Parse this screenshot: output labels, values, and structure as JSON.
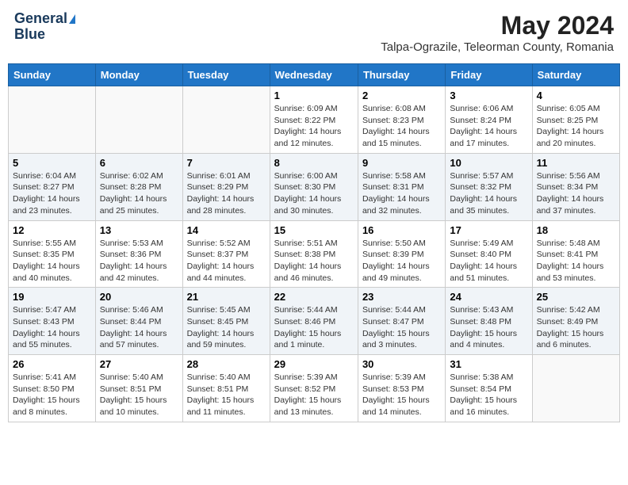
{
  "header": {
    "logo_line1": "General",
    "logo_line2": "Blue",
    "month_year": "May 2024",
    "location": "Talpa-Ograzile, Teleorman County, Romania"
  },
  "weekdays": [
    "Sunday",
    "Monday",
    "Tuesday",
    "Wednesday",
    "Thursday",
    "Friday",
    "Saturday"
  ],
  "weeks": [
    [
      {
        "day": "",
        "info": ""
      },
      {
        "day": "",
        "info": ""
      },
      {
        "day": "",
        "info": ""
      },
      {
        "day": "1",
        "info": "Sunrise: 6:09 AM\nSunset: 8:22 PM\nDaylight: 14 hours and 12 minutes."
      },
      {
        "day": "2",
        "info": "Sunrise: 6:08 AM\nSunset: 8:23 PM\nDaylight: 14 hours and 15 minutes."
      },
      {
        "day": "3",
        "info": "Sunrise: 6:06 AM\nSunset: 8:24 PM\nDaylight: 14 hours and 17 minutes."
      },
      {
        "day": "4",
        "info": "Sunrise: 6:05 AM\nSunset: 8:25 PM\nDaylight: 14 hours and 20 minutes."
      }
    ],
    [
      {
        "day": "5",
        "info": "Sunrise: 6:04 AM\nSunset: 8:27 PM\nDaylight: 14 hours and 23 minutes."
      },
      {
        "day": "6",
        "info": "Sunrise: 6:02 AM\nSunset: 8:28 PM\nDaylight: 14 hours and 25 minutes."
      },
      {
        "day": "7",
        "info": "Sunrise: 6:01 AM\nSunset: 8:29 PM\nDaylight: 14 hours and 28 minutes."
      },
      {
        "day": "8",
        "info": "Sunrise: 6:00 AM\nSunset: 8:30 PM\nDaylight: 14 hours and 30 minutes."
      },
      {
        "day": "9",
        "info": "Sunrise: 5:58 AM\nSunset: 8:31 PM\nDaylight: 14 hours and 32 minutes."
      },
      {
        "day": "10",
        "info": "Sunrise: 5:57 AM\nSunset: 8:32 PM\nDaylight: 14 hours and 35 minutes."
      },
      {
        "day": "11",
        "info": "Sunrise: 5:56 AM\nSunset: 8:34 PM\nDaylight: 14 hours and 37 minutes."
      }
    ],
    [
      {
        "day": "12",
        "info": "Sunrise: 5:55 AM\nSunset: 8:35 PM\nDaylight: 14 hours and 40 minutes."
      },
      {
        "day": "13",
        "info": "Sunrise: 5:53 AM\nSunset: 8:36 PM\nDaylight: 14 hours and 42 minutes."
      },
      {
        "day": "14",
        "info": "Sunrise: 5:52 AM\nSunset: 8:37 PM\nDaylight: 14 hours and 44 minutes."
      },
      {
        "day": "15",
        "info": "Sunrise: 5:51 AM\nSunset: 8:38 PM\nDaylight: 14 hours and 46 minutes."
      },
      {
        "day": "16",
        "info": "Sunrise: 5:50 AM\nSunset: 8:39 PM\nDaylight: 14 hours and 49 minutes."
      },
      {
        "day": "17",
        "info": "Sunrise: 5:49 AM\nSunset: 8:40 PM\nDaylight: 14 hours and 51 minutes."
      },
      {
        "day": "18",
        "info": "Sunrise: 5:48 AM\nSunset: 8:41 PM\nDaylight: 14 hours and 53 minutes."
      }
    ],
    [
      {
        "day": "19",
        "info": "Sunrise: 5:47 AM\nSunset: 8:43 PM\nDaylight: 14 hours and 55 minutes."
      },
      {
        "day": "20",
        "info": "Sunrise: 5:46 AM\nSunset: 8:44 PM\nDaylight: 14 hours and 57 minutes."
      },
      {
        "day": "21",
        "info": "Sunrise: 5:45 AM\nSunset: 8:45 PM\nDaylight: 14 hours and 59 minutes."
      },
      {
        "day": "22",
        "info": "Sunrise: 5:44 AM\nSunset: 8:46 PM\nDaylight: 15 hours and 1 minute."
      },
      {
        "day": "23",
        "info": "Sunrise: 5:44 AM\nSunset: 8:47 PM\nDaylight: 15 hours and 3 minutes."
      },
      {
        "day": "24",
        "info": "Sunrise: 5:43 AM\nSunset: 8:48 PM\nDaylight: 15 hours and 4 minutes."
      },
      {
        "day": "25",
        "info": "Sunrise: 5:42 AM\nSunset: 8:49 PM\nDaylight: 15 hours and 6 minutes."
      }
    ],
    [
      {
        "day": "26",
        "info": "Sunrise: 5:41 AM\nSunset: 8:50 PM\nDaylight: 15 hours and 8 minutes."
      },
      {
        "day": "27",
        "info": "Sunrise: 5:40 AM\nSunset: 8:51 PM\nDaylight: 15 hours and 10 minutes."
      },
      {
        "day": "28",
        "info": "Sunrise: 5:40 AM\nSunset: 8:51 PM\nDaylight: 15 hours and 11 minutes."
      },
      {
        "day": "29",
        "info": "Sunrise: 5:39 AM\nSunset: 8:52 PM\nDaylight: 15 hours and 13 minutes."
      },
      {
        "day": "30",
        "info": "Sunrise: 5:39 AM\nSunset: 8:53 PM\nDaylight: 15 hours and 14 minutes."
      },
      {
        "day": "31",
        "info": "Sunrise: 5:38 AM\nSunset: 8:54 PM\nDaylight: 15 hours and 16 minutes."
      },
      {
        "day": "",
        "info": ""
      }
    ]
  ]
}
